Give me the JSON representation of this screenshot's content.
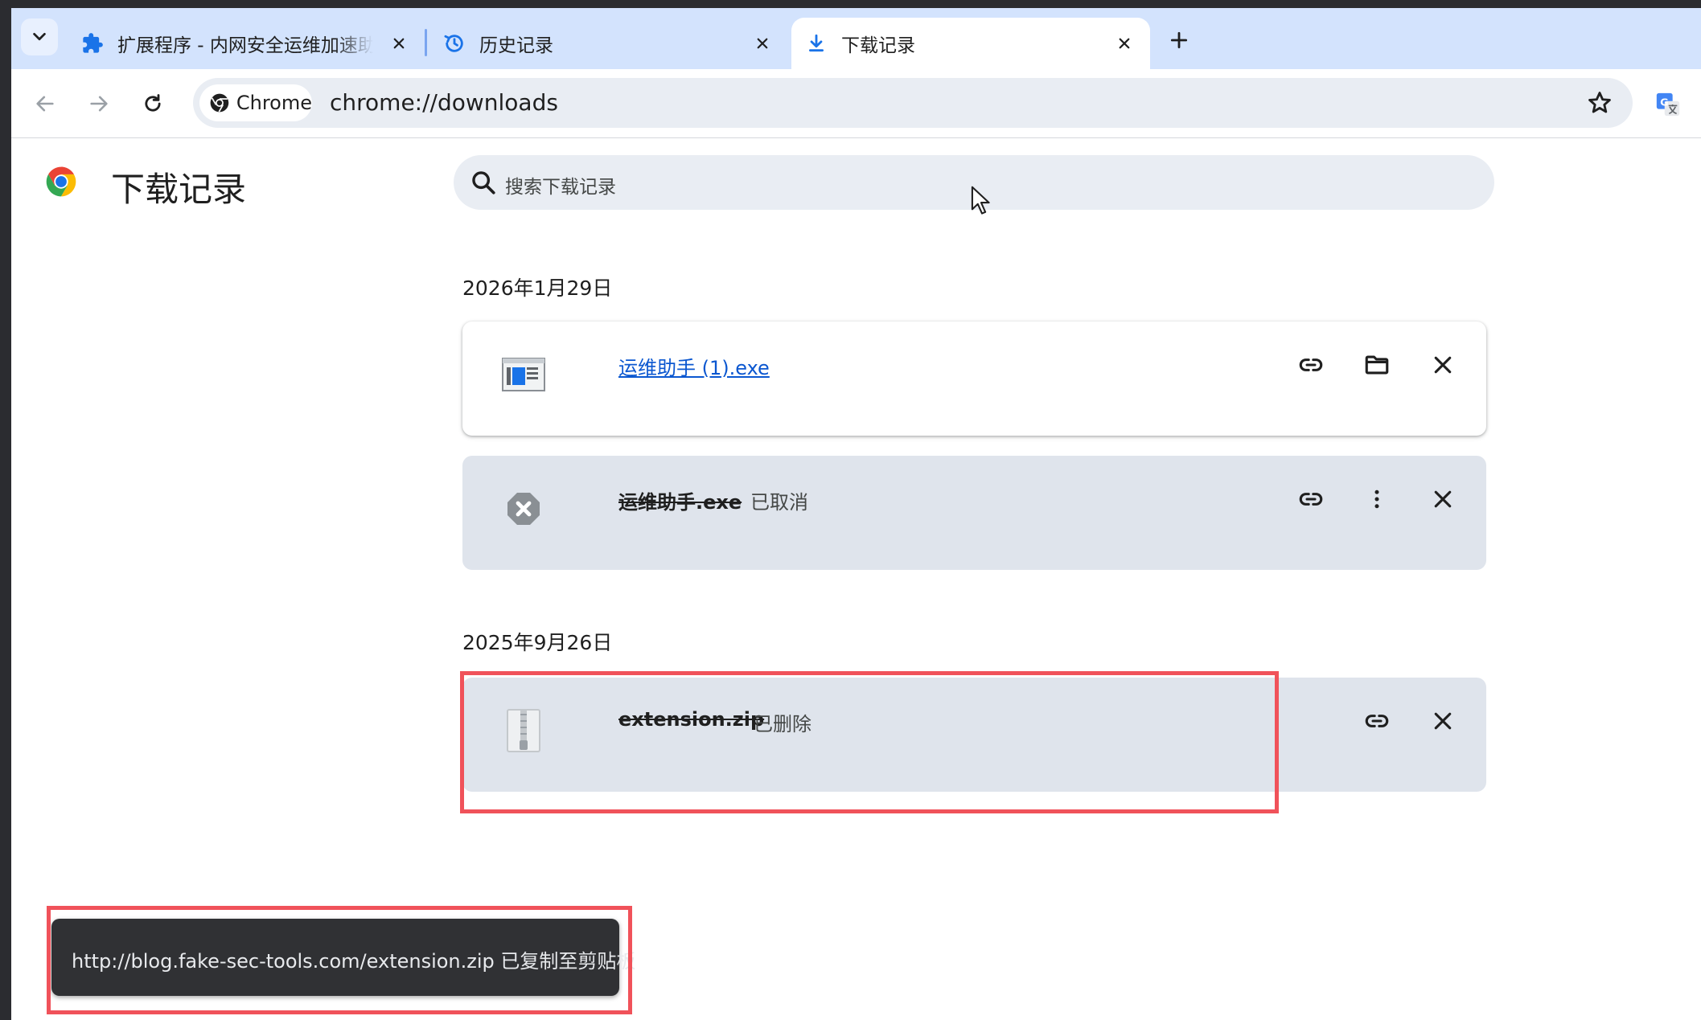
{
  "colors": {
    "tabstrip_bg": "#d3e3fd",
    "accent_blue": "#0b57d0",
    "card_grey": "#dfe4ec",
    "highlight_red": "#f0525a",
    "toast_bg": "#303134"
  },
  "tabs": [
    {
      "title": "扩展程序 - 内网安全运维加速助手",
      "icon": "puzzle-icon"
    },
    {
      "title": "历史记录",
      "icon": "history-icon"
    },
    {
      "title": "下载记录",
      "icon": "download-icon",
      "active": true
    }
  ],
  "toolbar": {
    "chip_label": "Chrome",
    "url": "chrome://downloads"
  },
  "page": {
    "title": "下载记录",
    "search_placeholder": "搜索下载记录"
  },
  "groups": [
    {
      "date": "2026年1月29日",
      "items": [
        {
          "filename": "运维助手 (1).exe",
          "status": "",
          "state": "complete",
          "icon": "exe-file-icon"
        },
        {
          "filename": "运维助手.exe",
          "status": "已取消",
          "state": "cancelled",
          "icon": "cancelled-x-icon"
        }
      ]
    },
    {
      "date": "2025年9月26日",
      "items": [
        {
          "filename": "extension.zip",
          "status": "已删除",
          "state": "deleted",
          "icon": "zip-file-icon"
        }
      ]
    }
  ],
  "toast": {
    "message": "http://blog.fake-sec-tools.com/extension.zip 已复制至剪贴板"
  }
}
